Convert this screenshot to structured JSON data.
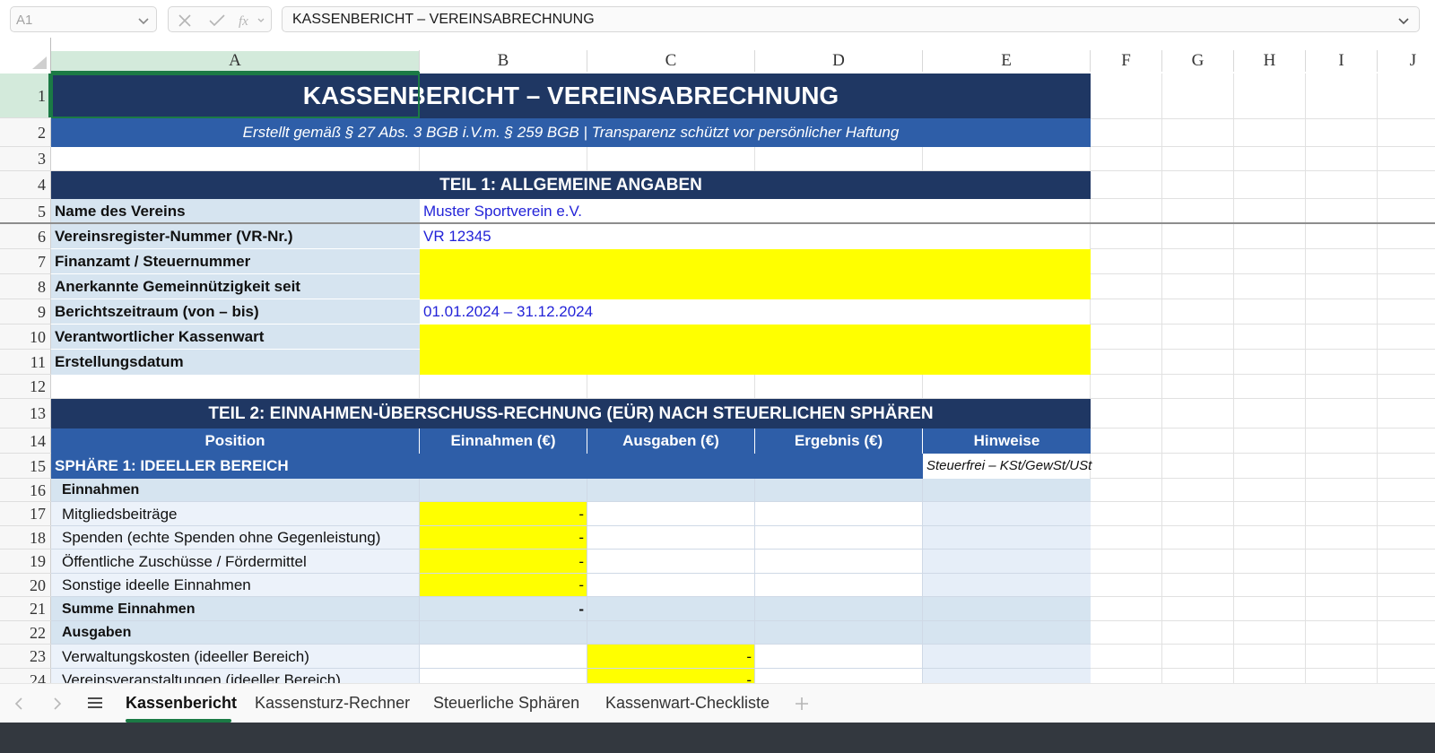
{
  "formula_bar": {
    "name_box": "A1",
    "formula": "KASSENBERICHT – VEREINSABRECHNUNG"
  },
  "columns": [
    "A",
    "B",
    "C",
    "D",
    "E",
    "F",
    "G",
    "H",
    "I",
    "J"
  ],
  "rows": [
    "1",
    "2",
    "3",
    "4",
    "5",
    "6",
    "7",
    "8",
    "9",
    "10",
    "11",
    "12",
    "13",
    "14",
    "15",
    "16",
    "17",
    "18",
    "19",
    "20",
    "21",
    "22",
    "23",
    "24"
  ],
  "sheet": {
    "title": "KASSENBERICHT – VEREINSABRECHNUNG",
    "subtitle": "Erstellt gemäß § 27 Abs. 3 BGB i.V.m. § 259 BGB | Transparenz schützt vor persönlicher Haftung",
    "part1_header": "TEIL 1: ALLGEMEINE ANGABEN",
    "general": [
      {
        "label": "Name des Vereins",
        "value": ""
      },
      {
        "label": "Vereinsregister-Nummer (VR-Nr.)",
        "value": ""
      },
      {
        "label": "Finanzamt / Steuernummer",
        "value": ""
      },
      {
        "label": "Anerkannte Gemeinnützigkeit seit",
        "value": ""
      },
      {
        "label": "Berichtszeitraum (von – bis)",
        "value": ""
      },
      {
        "label": "Verantwortlicher Kassenwart",
        "value": ""
      },
      {
        "label": "Erstellungsdatum",
        "value": ""
      }
    ],
    "values": {
      "name": "Muster Sportverein e.V.",
      "vr": "VR 12345",
      "period": "01.01.2024 – 31.12.2024"
    },
    "part2_header": "TEIL 2: EINNAHMEN-ÜBERSCHUSS-RECHNUNG (EÜR) NACH STEUERLICHEN SPHÄREN",
    "table_headers": [
      "Position",
      "Einnahmen (€)",
      "Ausgaben (€)",
      "Ergebnis (€)",
      "Hinweise"
    ],
    "sphere1": "SPHÄRE 1: IDEELLER BEREICH",
    "sphere1_note": "Steuerfrei – KSt/GewSt/USt",
    "income_header": "Einnahmen",
    "income_items": [
      "Mitgliedsbeiträge",
      "Spenden (echte Spenden ohne Gegenleistung)",
      "Öffentliche Zuschüsse / Fördermittel",
      "Sonstige ideelle Einnahmen"
    ],
    "dash": "-",
    "income_sum": "Summe Einnahmen",
    "expense_header": "Ausgaben",
    "expense_items": [
      "Verwaltungskosten (ideeller Bereich)",
      "Vereinsveranstaltungen (ideeller Bereich)"
    ]
  },
  "tabs": [
    "Kassenbericht",
    "Kassensturz-Rechner",
    "Steuerliche Sphären",
    "Kassenwart-Checkliste"
  ],
  "icons": [
    "chevron-down-icon",
    "cancel-icon",
    "check-icon",
    "function-icon",
    "nav-left-icon",
    "nav-right-icon",
    "sheet-list-icon",
    "add-sheet-icon"
  ]
}
